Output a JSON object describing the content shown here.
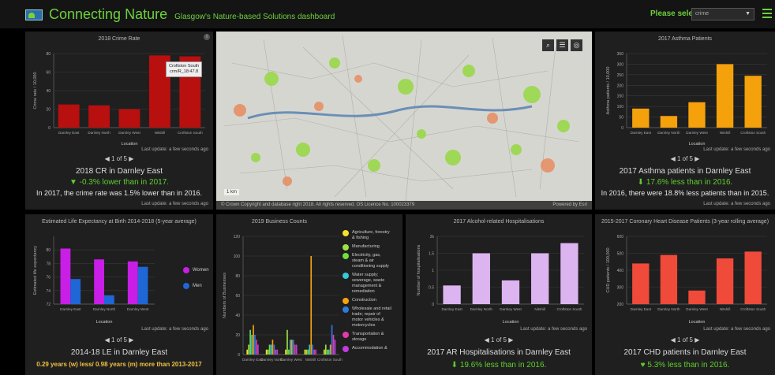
{
  "header": {
    "title": "Connecting Nature",
    "subtitle": "Glasgow's Nature-based Solutions dashboard",
    "select_label": "Please select",
    "select_value": "crime"
  },
  "crime": {
    "title": "2018 Crime Rate",
    "ylabel": "Crime rate / 10,000",
    "xlabel": "Location",
    "pager": "1 of 5",
    "updated": "Last update: a few seconds ago",
    "headline": "2018 CR in Darnley East",
    "change": "-0.3% lower than in 2017.",
    "desc": "In 2017, the crime rate was 1.5% lower than in 2016.",
    "updated2": "Last update: a few seconds ago",
    "tooltip_name": "Croftston South",
    "tooltip_value": "crm/R_18:47.8"
  },
  "map": {
    "credit": "© Crown Copyright and database right 2018. All rights reserved. OS Licence No. 100023379",
    "powered": "Powered by Esri",
    "scale": "1 km"
  },
  "asthma": {
    "title": "2017 Asthma Patients",
    "ylabel": "Asthma patients / 10,000",
    "xlabel": "Location",
    "pager": "1 of 5",
    "updated": "Last update: a few seconds ago",
    "headline": "2017 Asthma patients in Darnley East",
    "change": "17.6% less than in 2016.",
    "desc": "In 2016, there were 18.8% less patients than in 2015.",
    "updated2": "Last update: a few seconds ago"
  },
  "life": {
    "title": "Estimated Life Expectancy at Birth 2014-2018 (5-year average)",
    "ylabel": "Estimated life expectancy",
    "xlabel": "Location",
    "pager": "1 of 5",
    "updated": "Last update: a few seconds ago",
    "headline": "2014-18 LE in Darnley East",
    "desc": "0.29 years (w) less/ 0.98 years (m) more than 2013-2017",
    "legend": [
      "Women",
      "Men"
    ]
  },
  "business": {
    "title": "2019 Business Counts",
    "ylabel": "Numbers of Businesses",
    "legend": [
      "Agriculture, forestry & fishing",
      "Manufacturing",
      "Electricity, gas, steam & air conditioning supply",
      "Water supply; sewerage, waste management & remediation",
      "Construction",
      "Wholesale and retail trade; repair of motor vehicles & motorcycles",
      "Transportation & storage",
      "Accommodation &"
    ]
  },
  "alcohol": {
    "title": "2017 Alcohol-related Hospitalisations",
    "ylabel": "Number of hospitalisations",
    "xlabel": "Location",
    "pager": "1 of 5",
    "updated": "Last update: a few seconds ago",
    "headline": "2017 AR Hospitalisations in Darnley East",
    "change": "19.6% less than in 2016."
  },
  "chd": {
    "title": "2015-2017 Coronary Heart Disease Patients (3-year rolling average)",
    "ylabel": "CHD patients / 100,000",
    "xlabel": "Location",
    "pager": "1 of 5",
    "updated": "Last update: a few seconds ago",
    "headline": "2017 CHD patients in Darnley East",
    "change": "5.3% less than in 2016."
  },
  "colors": {
    "crime": "#b80f0f",
    "asthma": "#f5a10c",
    "women": "#c81ee6",
    "men": "#1f66d6",
    "alcohol": "#dcb4f0",
    "chd": "#f04a3a",
    "accent": "#6dd13c"
  },
  "chart_data": [
    {
      "type": "bar",
      "title": "2018 Crime Rate",
      "categories": [
        "Darnley East",
        "Darnley North",
        "Darnley West",
        "Nitshill",
        "Croftston South"
      ],
      "values": [
        25,
        24,
        20,
        78,
        77
      ],
      "ylim": [
        0,
        80
      ],
      "yticks": [
        0,
        20,
        40,
        60,
        80
      ],
      "ylabel": "Crime rate / 10,000",
      "xlabel": "Location"
    },
    {
      "type": "bar",
      "title": "2017 Asthma Patients",
      "categories": [
        "Darnley East",
        "Darnley North",
        "Darnley West",
        "Nitshill",
        "Croftston South"
      ],
      "values": [
        90,
        55,
        120,
        300,
        245
      ],
      "ylim": [
        0,
        350
      ],
      "yticks": [
        0,
        50,
        100,
        150,
        200,
        250,
        300,
        350
      ],
      "ylabel": "Asthma patients / 10,000",
      "xlabel": "Location"
    },
    {
      "type": "bar",
      "title": "Estimated Life Expectancy at Birth 2014-2018 (5-year average)",
      "categories": [
        "Darnley East",
        "Darnley North",
        "Darnley West"
      ],
      "series": [
        {
          "name": "Women",
          "values": [
            80.2,
            78.6,
            78.3
          ]
        },
        {
          "name": "Men",
          "values": [
            75.7,
            73.3,
            77.5
          ]
        }
      ],
      "ylim": [
        72,
        82
      ],
      "yticks": [
        72,
        74,
        76,
        78,
        80
      ],
      "ylabel": "Estimated life expectancy",
      "xlabel": "Location"
    },
    {
      "type": "bar",
      "title": "2019 Business Counts",
      "categories": [
        "Darnley East",
        "Darnley North",
        "Darnley West",
        "Nitshill",
        "Croftston South"
      ],
      "series": [
        {
          "name": "Agriculture, forestry & fishing",
          "values": [
            5,
            5,
            5,
            5,
            5
          ]
        },
        {
          "name": "Manufacturing",
          "values": [
            10,
            5,
            25,
            5,
            10
          ]
        },
        {
          "name": "Electricity, gas, steam & air conditioning supply",
          "values": [
            25,
            10,
            5,
            5,
            5
          ]
        },
        {
          "name": "Water supply; sewerage, waste management & remediation",
          "values": [
            20,
            10,
            15,
            10,
            5
          ]
        },
        {
          "name": "Construction",
          "values": [
            30,
            15,
            15,
            100,
            10
          ]
        },
        {
          "name": "Wholesale and retail trade; repair of motor vehicles & motorcycles",
          "values": [
            20,
            10,
            15,
            10,
            30
          ]
        },
        {
          "name": "Transportation & storage",
          "values": [
            15,
            5,
            10,
            5,
            20
          ]
        },
        {
          "name": "Accommodation &",
          "values": [
            10,
            5,
            10,
            5,
            15
          ]
        }
      ],
      "ylim": [
        0,
        120
      ],
      "yticks": [
        0,
        20,
        40,
        60,
        80,
        100,
        120
      ],
      "ylabel": "Numbers of Businesses"
    },
    {
      "type": "bar",
      "title": "2017 Alcohol-related Hospitalisations",
      "categories": [
        "Darnley East",
        "Darnley North",
        "Darnley West",
        "Nitshill",
        "Croftston South"
      ],
      "values": [
        0.55,
        1.5,
        0.7,
        1.5,
        1.8
      ],
      "ylim": [
        0,
        2
      ],
      "yticks": [
        0,
        0.5,
        1,
        1.5,
        2
      ],
      "yticklabels": [
        "0",
        "0.5",
        "1",
        "1.5",
        "2k"
      ],
      "ylabel": "Number of hospitalisations",
      "xlabel": "Location"
    },
    {
      "type": "bar",
      "title": "2015-2017 Coronary Heart Disease Patients (3-year rolling average)",
      "categories": [
        "Darnley East",
        "Darnley North",
        "Darnley West",
        "Nitshill",
        "Croftston South"
      ],
      "values": [
        440,
        490,
        280,
        470,
        510
      ],
      "ylim": [
        200,
        600
      ],
      "yticks": [
        200,
        300,
        400,
        500,
        600
      ],
      "ylabel": "CHD patients / 100,000",
      "xlabel": "Location"
    }
  ]
}
